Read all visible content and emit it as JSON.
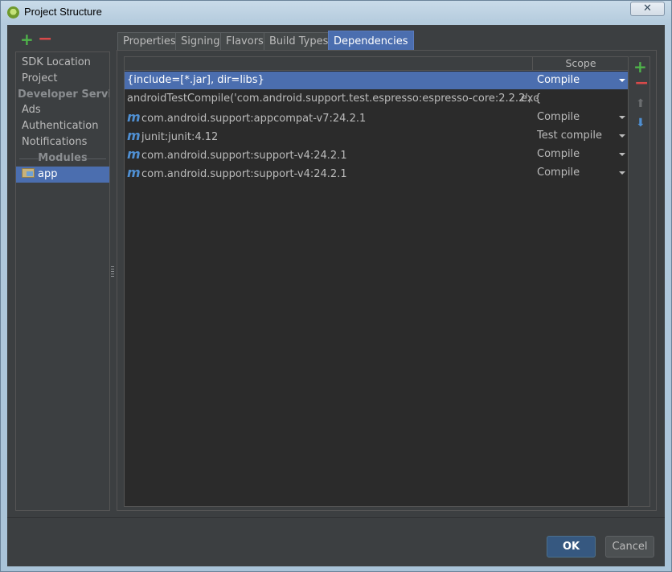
{
  "window": {
    "title": "Project Structure",
    "close_glyph": "✕"
  },
  "left_toolbar": {
    "add": "+",
    "remove": "−"
  },
  "sidebar": {
    "items": [
      {
        "label": "SDK Location"
      },
      {
        "label": "Project"
      },
      {
        "label": "Developer Servic..."
      },
      {
        "label": "Ads"
      },
      {
        "label": "Authentication"
      },
      {
        "label": "Notifications"
      },
      {
        "label": "Modules"
      },
      {
        "label": "app"
      }
    ]
  },
  "tabs": [
    {
      "label": "Properties"
    },
    {
      "label": "Signing"
    },
    {
      "label": "Flavors"
    },
    {
      "label": "Build Types"
    },
    {
      "label": "Dependencies",
      "active": true
    }
  ],
  "table": {
    "headers": {
      "dependency": "",
      "scope": "Scope"
    },
    "rows": [
      {
        "dependency": "{include=[*.jar], dir=libs}",
        "scope": "Compile",
        "icon": "",
        "selected": true
      },
      {
        "dependency": "androidTestCompile('com.android.support.test.espresso:espresso-core:2.2.2', {",
        "scope": "",
        "overflow": "exc",
        "icon": ""
      },
      {
        "dependency": "com.android.support:appcompat-v7:24.2.1",
        "scope": "Compile",
        "icon": "maven-icon"
      },
      {
        "dependency": "junit:junit:4.12",
        "scope": "Test compile",
        "icon": "maven-icon"
      },
      {
        "dependency": "com.android.support:support-v4:24.2.1",
        "scope": "Compile",
        "icon": "maven-icon"
      },
      {
        "dependency": "com.android.support:support-v4:24.2.1",
        "scope": "Compile",
        "icon": "maven-icon"
      }
    ]
  },
  "right_toolbar": {
    "add": "+",
    "remove": "−",
    "up": "⬆",
    "down": "⬇"
  },
  "buttons": {
    "ok": "OK",
    "cancel": "Cancel"
  },
  "colors": {
    "selection": "#4b6eaf",
    "background": "#3c3f41",
    "table_bg": "#2b2b2b"
  }
}
